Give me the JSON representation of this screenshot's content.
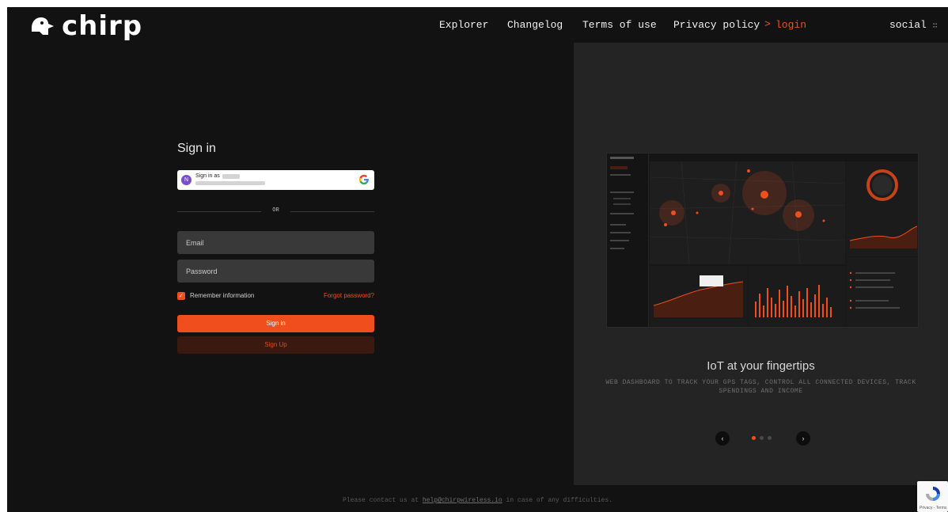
{
  "header": {
    "logo_text": "chirp",
    "nav": [
      "Explorer",
      "Changelog",
      "Terms of use",
      "Privacy policy"
    ],
    "nav_separator": ">",
    "active": "login",
    "social": "social",
    "social_icon": "grid-dots-icon"
  },
  "signin": {
    "title": "Sign in",
    "google_label": "Sign in as",
    "google_avatar_letter": "N",
    "or_text": "OR",
    "email_placeholder": "Email",
    "password_placeholder": "Password",
    "remember_label": "Remember information",
    "remember_checked": true,
    "forgot_link": "Forgot password?",
    "signin_button": "Sign in",
    "signup_button": "Sign Up"
  },
  "carousel": {
    "title": "IoT at your fingertips",
    "subtitle": "WEB DASHBOARD TO TRACK YOUR GPS TAGS, CONTROL ALL CONNECTED DEVICES, TRACK SPENDINGS AND INCOME",
    "prev_icon": "chevron-left-icon",
    "next_icon": "chevron-right-icon",
    "slides_count": 3,
    "active_slide": 1
  },
  "footer": {
    "prefix": "Please contact us at",
    "email": "help@chirpwireless.io",
    "suffix": "in case of any difficulties."
  },
  "recaptcha": {
    "text": "Privacy - Terms"
  },
  "colors": {
    "accent": "#f04e1c",
    "background": "#121212",
    "panel": "#242424",
    "field": "#393939"
  }
}
